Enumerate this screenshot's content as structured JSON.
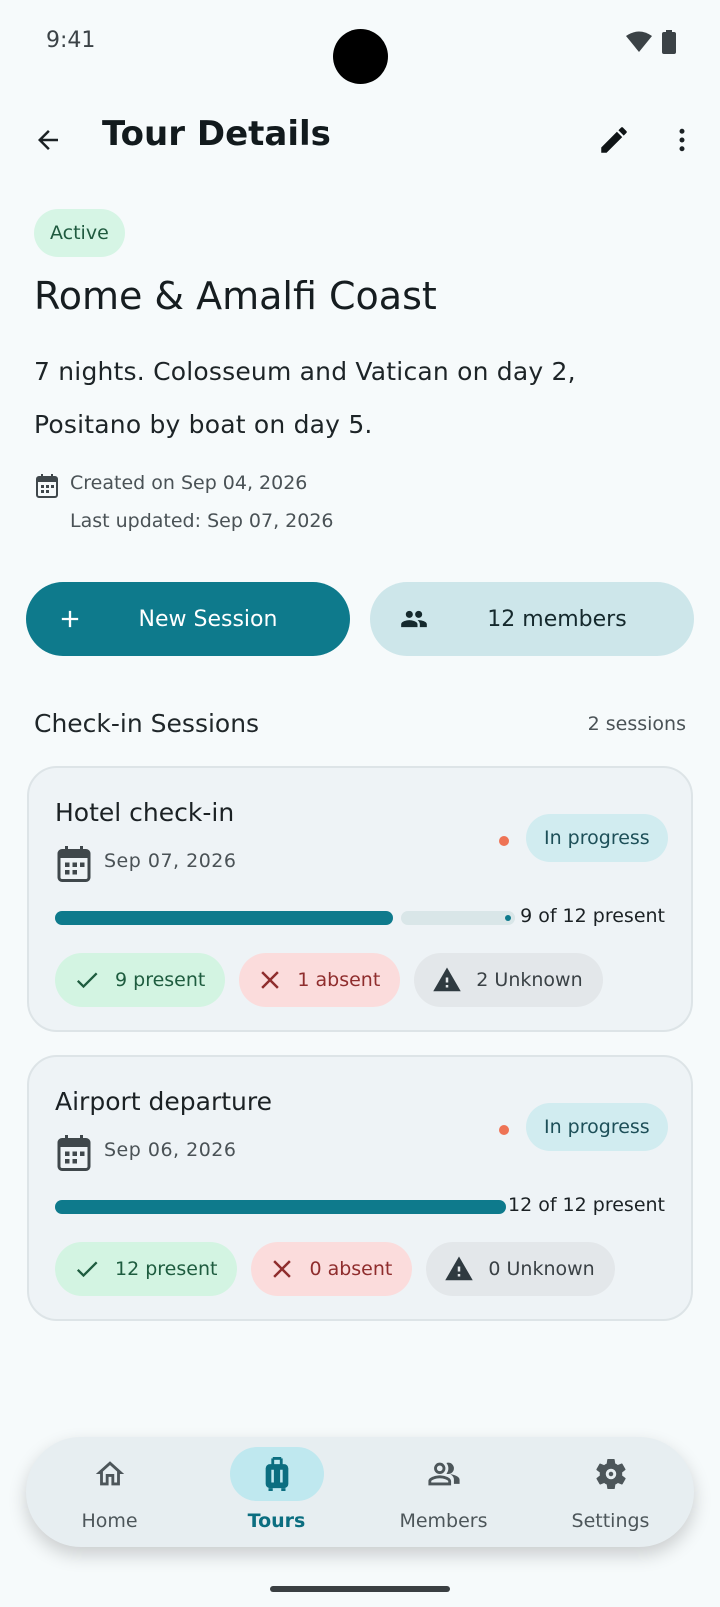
{
  "status_bar": {
    "time": "9:41"
  },
  "app_bar": {
    "title": "Tour Details"
  },
  "tour": {
    "status": "Active",
    "name": "Rome & Amalfi Coast",
    "description": "7 nights. Colosseum and Vatican on day 2, Positano by boat on day 5.",
    "created": "Created on Sep 04, 2026",
    "updated": "Last updated: Sep 07, 2026"
  },
  "actions": {
    "new_session": "New Session",
    "members": "12 members"
  },
  "sessions": {
    "title": "Check-in Sessions",
    "count": "2 sessions",
    "items": [
      {
        "title": "Hotel check-in",
        "date": "Sep 07, 2026",
        "status": "In progress",
        "progress": 0.75,
        "ratio": "9 of 12 present",
        "present": "9 present",
        "absent": "1 absent",
        "unknown": "2 Unknown"
      },
      {
        "title": "Airport departure",
        "date": "Sep 06, 2026",
        "status": "In progress",
        "progress": 1.0,
        "ratio": "12 of 12 present",
        "present": "12 present",
        "absent": "0 absent",
        "unknown": "0 Unknown"
      }
    ]
  },
  "nav": {
    "items": [
      {
        "label": "Home",
        "icon": "home-icon"
      },
      {
        "label": "Tours",
        "icon": "luggage-icon",
        "active": true
      },
      {
        "label": "Members",
        "icon": "people-icon"
      },
      {
        "label": "Settings",
        "icon": "gear-icon"
      }
    ]
  },
  "colors": {
    "accent": "#0e7a8c",
    "status_dot": "#ee7355"
  }
}
